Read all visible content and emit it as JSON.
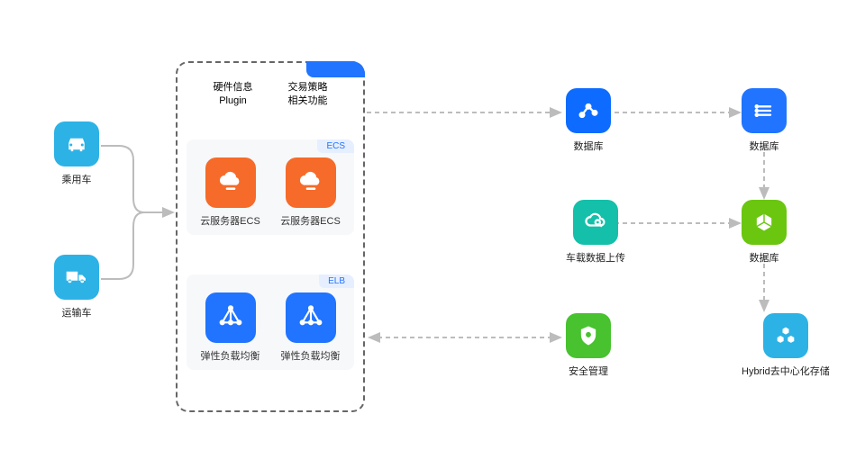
{
  "left": {
    "car": "乘用车",
    "truck": "运输车"
  },
  "center": {
    "header1_line1": "硬件信息",
    "header1_line2": "Plugin",
    "header2_line1": "交易策略",
    "header2_line2": "相关功能",
    "ecs_tag": "ECS",
    "ecs_label": "云服务器ECS",
    "elb_tag": "ELB",
    "elb_label": "弹性负载均衡"
  },
  "right": {
    "graph": "数据库",
    "cloudsearch": "车载数据上传",
    "shield": "安全管理",
    "lines": "数据库",
    "greendb": "数据库",
    "hbase": "Hybrid去中心化存储"
  }
}
